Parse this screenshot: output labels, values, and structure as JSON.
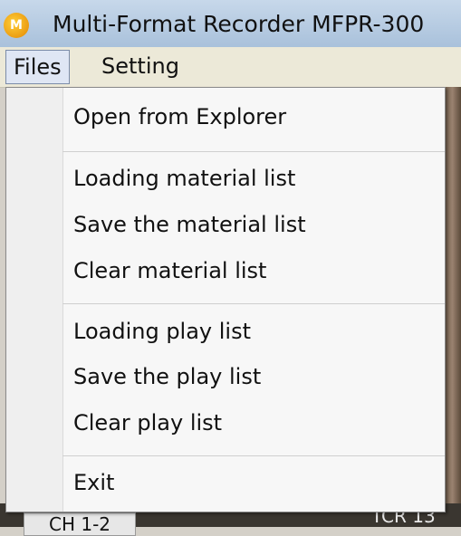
{
  "window": {
    "title": "Multi-Format Recorder  MFPR-300",
    "icon_label": "M"
  },
  "menubar": {
    "items": [
      {
        "label": "Files",
        "active": true
      },
      {
        "label": "Setting",
        "active": false
      }
    ]
  },
  "files_menu": {
    "items": [
      {
        "label": "Open from Explorer"
      },
      {
        "label": "Loading material list"
      },
      {
        "label": "Save the material list"
      },
      {
        "label": "Clear material list"
      },
      {
        "label": "Loading play list"
      },
      {
        "label": "Save the play list"
      },
      {
        "label": "Clear play list"
      },
      {
        "label": "Exit"
      }
    ]
  },
  "background": {
    "channel_label": "CH 1-2",
    "tcr_label": "TCR 13"
  },
  "colors": {
    "titlebar": "#a9c1db",
    "menu_bg": "#f7f7f7",
    "active_menu": "#dfe6f4"
  }
}
